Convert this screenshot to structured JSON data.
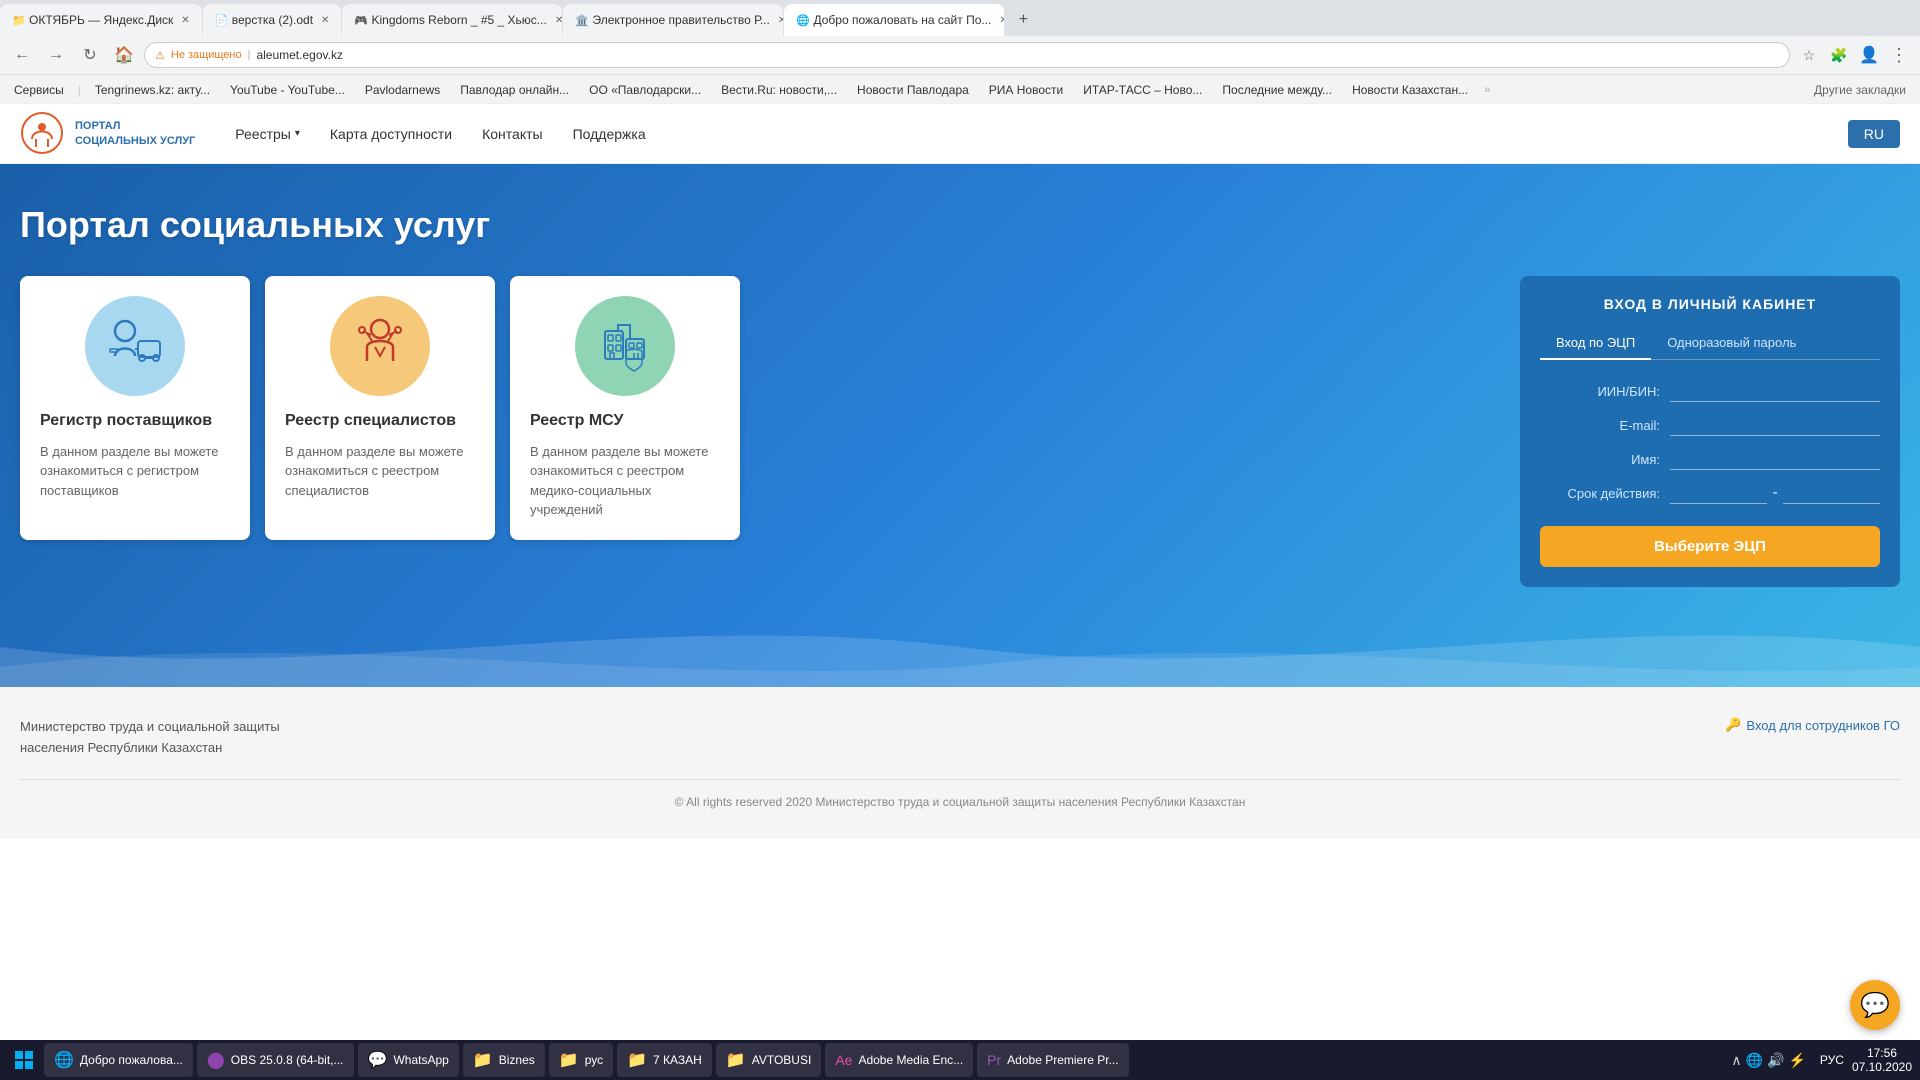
{
  "browser": {
    "tabs": [
      {
        "id": "tab1",
        "label": "ОКТЯБРЬ — Яндекс.Диск",
        "active": false
      },
      {
        "id": "tab2",
        "label": "верстка (2).odt",
        "active": false
      },
      {
        "id": "tab3",
        "label": "Kingdoms Reborn _ #5 _ Хьюс...",
        "active": false
      },
      {
        "id": "tab4",
        "label": "Электронное правительство Р...",
        "active": false
      },
      {
        "id": "tab5",
        "label": "Добро пожаловать на сайт По...",
        "active": true
      }
    ],
    "address": "aleumet.egov.kz",
    "security": "Не защищено",
    "bookmarks": [
      "Сервисы",
      "Tengrinews.kz: акту...",
      "YouTube - YouTube...",
      "Pavlodarnews",
      "Павлодар онлайн...",
      "ОО «Павлодарски...",
      "Вести.Ru: новости,...",
      "Новости Павлодара",
      "РИА Новости",
      "ИТАР-ТАСС – Ново...",
      "Последние между...",
      "Новости Казахстан...",
      "Другие закладки"
    ]
  },
  "header": {
    "logo_text_line1": "ПОРТАЛ",
    "logo_text_line2": "СОЦИАЛЬНЫХ УСЛУГ",
    "nav": {
      "registries": "Реестры",
      "accessibility_map": "Карта доступности",
      "contacts": "Контакты",
      "support": "Поддержка"
    },
    "lang_button": "RU"
  },
  "hero": {
    "title": "Портал социальных услуг",
    "cards": [
      {
        "id": "card1",
        "title": "Регистр поставщиков",
        "description": "В данном разделе вы можете ознакомиться с регистром поставщиков",
        "icon": "👤🚗",
        "icon_color": "blue"
      },
      {
        "id": "card2",
        "title": "Реестр специалистов",
        "description": "В данном разделе вы можете ознакомиться с реестром специалистов",
        "icon": "⚡",
        "icon_color": "orange"
      },
      {
        "id": "card3",
        "title": "Реестр МСУ",
        "description": "В данном разделе вы можете ознакомиться с реестром медико-социальных учреждений",
        "icon": "🏛️",
        "icon_color": "green"
      }
    ]
  },
  "login_box": {
    "title": "ВХОД В ЛИЧНЫЙ КАБИНЕТ",
    "tab_ecp": "Вход по ЭЦП",
    "tab_otp": "Одноразовый пароль",
    "fields": {
      "iin_bin": "ИИН/БИН:",
      "email": "E-mail:",
      "name": "Имя:",
      "validity": "Срок действия:"
    },
    "submit_button": "Выберите ЭЦП"
  },
  "footer": {
    "ministry_line1": "Министерство труда и социальной защиты",
    "ministry_line2": "населения Республики Казахстан",
    "staff_login": "Вход для сотрудников ГО",
    "copyright": "© All rights reserved 2020 Министерство труда и социальной защиты населения Республики Казахстан"
  },
  "taskbar": {
    "items": [
      {
        "id": "item1",
        "label": "Добро пожалова...",
        "icon": "🌐"
      },
      {
        "id": "item2",
        "label": "OBS 25.0.8 (64-bit,...",
        "icon": "⭕"
      },
      {
        "id": "item3",
        "label": "WhatsApp",
        "icon": "💬"
      },
      {
        "id": "item4",
        "label": "Biznes",
        "icon": "📁"
      },
      {
        "id": "item5",
        "label": "рус",
        "icon": "📁"
      },
      {
        "id": "item6",
        "label": "7 КАЗАН",
        "icon": "📁"
      },
      {
        "id": "item7",
        "label": "AVTOBUSI",
        "icon": "📁"
      },
      {
        "id": "item8",
        "label": "Adobe Media Enc...",
        "icon": "🎬"
      },
      {
        "id": "item9",
        "label": "Adobe Premiere Pr...",
        "icon": "🎞️"
      }
    ],
    "time": "17:56",
    "date": "07.10.2020",
    "lang": "РУС"
  }
}
